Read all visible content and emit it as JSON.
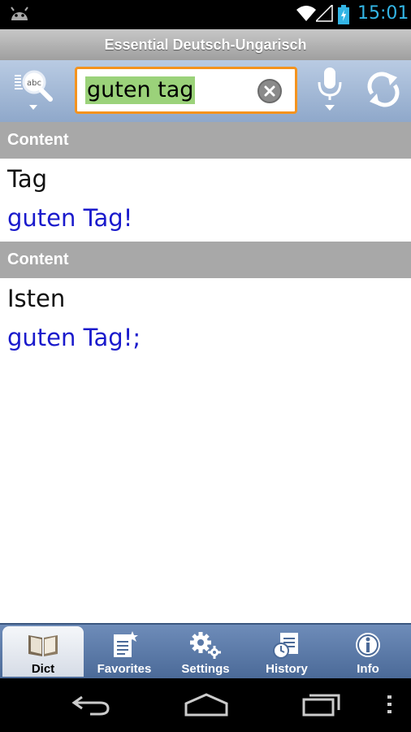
{
  "status_bar": {
    "time": "15:01",
    "accent": "#33b5e5"
  },
  "app": {
    "title": "Essential Deutsch-Ungarisch"
  },
  "search": {
    "value": "guten tag",
    "highlight": "#9bd27a",
    "border": "#f4931e"
  },
  "results": [
    {
      "header": "Content",
      "word": "Tag",
      "translation": "guten Tag!"
    },
    {
      "header": "Content",
      "word": "Isten",
      "translation": "guten Tag!;"
    }
  ],
  "colors": {
    "translation": "#1a1acc",
    "section_header": "#a8a8a8"
  },
  "tabs": [
    {
      "label": "Dict",
      "icon": "book-icon",
      "active": true
    },
    {
      "label": "Favorites",
      "icon": "favorites-icon",
      "active": false
    },
    {
      "label": "Settings",
      "icon": "gears-icon",
      "active": false
    },
    {
      "label": "History",
      "icon": "history-icon",
      "active": false
    },
    {
      "label": "Info",
      "icon": "info-icon",
      "active": false
    }
  ],
  "nav": [
    "back-icon",
    "home-icon",
    "recents-icon",
    "menu-icon"
  ]
}
